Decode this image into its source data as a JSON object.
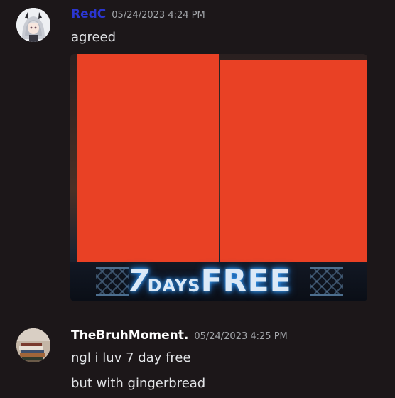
{
  "messages": [
    {
      "username": "RedC",
      "username_color": "#2b36d1",
      "timestamp": "05/24/2023 4:24 PM",
      "lines": [
        "agreed"
      ],
      "attachment": {
        "banner_seven": "7",
        "banner_days": "DAYS",
        "banner_free": "FREE"
      }
    },
    {
      "username": "TheBruhMoment.",
      "username_color": "#ffffff",
      "timestamp": "05/24/2023 4:25 PM",
      "lines": [
        "ngl i luv 7 day free",
        "but with gingerbread"
      ]
    }
  ],
  "colors": {
    "background": "#1c1719",
    "redaction": "#e94125",
    "timestamp": "#a3a6aa"
  }
}
